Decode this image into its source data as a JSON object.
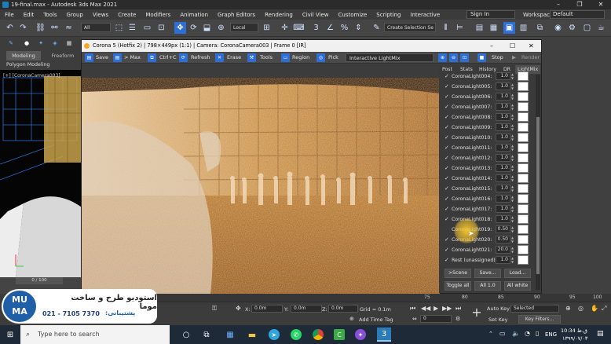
{
  "app": {
    "window_title": "19-final.max - Autodesk 3ds Max 2021"
  },
  "menu": [
    "File",
    "Edit",
    "Tools",
    "Group",
    "Views",
    "Create",
    "Modifiers",
    "Animation",
    "Graph Editors",
    "Rendering",
    "Civil View",
    "Customize",
    "Scripting",
    "Interactive"
  ],
  "account": {
    "sign_in": "Sign In",
    "workspaces_label": "Workspaces:",
    "workspace": "Default"
  },
  "toolbar": {
    "filter": "All",
    "ref_coord": "Local",
    "selection_set": "Create Selection Se"
  },
  "ribbon": {
    "tab_modeling": "Modeling",
    "tab_freeform": "Freeform",
    "poly_modeling": "Polygon Modeling"
  },
  "viewport": {
    "label": "[+] [CoronaCamera003]"
  },
  "vfb": {
    "title": "Corona 5 (Hotfix 2) | 798×449px (1:1) | Camera: CoronaCamera003 | Frame 0 [IR]",
    "save": "Save",
    "max": "> Max",
    "ctrlc": "Ctrl+C",
    "refresh": "Refresh",
    "erase": "Erase",
    "tools": "Tools",
    "region": "Region",
    "pick": "Pick",
    "mode": "Interactive LightMix",
    "stop": "Stop",
    "render": "Render"
  },
  "panel": {
    "tabs": [
      "Post",
      "Stats",
      "History",
      "DR",
      "LightMix"
    ],
    "lights": [
      {
        "name": "CoronaLight004:",
        "value": "1.0",
        "checked": true
      },
      {
        "name": "CoronaLight005:",
        "value": "1.0",
        "checked": true
      },
      {
        "name": "CoronaLight006:",
        "value": "1.0",
        "checked": true
      },
      {
        "name": "CoronaLight007:",
        "value": "1.0",
        "checked": true
      },
      {
        "name": "CoronaLight008:",
        "value": "1.0",
        "checked": true
      },
      {
        "name": "CoronaLight009:",
        "value": "1.0",
        "checked": true
      },
      {
        "name": "CoronaLight010:",
        "value": "1.0",
        "checked": true
      },
      {
        "name": "CoronaLight011:",
        "value": "1.0",
        "checked": true
      },
      {
        "name": "CoronaLight012:",
        "value": "1.0",
        "checked": true
      },
      {
        "name": "CoronaLight013:",
        "value": "1.0",
        "checked": true
      },
      {
        "name": "CoronaLight014:",
        "value": "1.0",
        "checked": true
      },
      {
        "name": "CoronaLight015:",
        "value": "1.0",
        "checked": true
      },
      {
        "name": "CoronaLight016:",
        "value": "1.0",
        "checked": true
      },
      {
        "name": "CoronaLight017:",
        "value": "1.0",
        "checked": true
      },
      {
        "name": "CoronaLight018:",
        "value": "1.0",
        "checked": true
      },
      {
        "name": "CoronaLight019:",
        "value": "0.50",
        "checked": false
      },
      {
        "name": "CoronaLight020:",
        "value": "0.50",
        "checked": true
      },
      {
        "name": "CoronaLight021:",
        "value": "20.0",
        "checked": true
      },
      {
        "name": "Rest (unassigned):",
        "value": "1.0",
        "checked": true
      }
    ],
    "btn_scene": ">Scene",
    "btn_save": "Save...",
    "btn_load": "Load...",
    "btn_toggle": "Toggle all",
    "btn_all": "All 1.0",
    "btn_white": "All white"
  },
  "timeline": {
    "frame": "0 / 100",
    "ticks": [
      "75",
      "80",
      "85",
      "90",
      "95",
      "100"
    ]
  },
  "status": {
    "x_label": "X:",
    "x": "0.0m",
    "y_label": "Y:",
    "y": "0.0m",
    "z_label": "Z:",
    "z": "0.0m",
    "grid": "Grid = 0.1m",
    "add_time_tag": "Add Time Tag",
    "auto_key": "Auto Key",
    "set_key": "Set Key",
    "selected": "Selected",
    "key_filters": "Key Filters...",
    "frame_field": "0"
  },
  "logo": {
    "letters_top": "MU",
    "letters_bottom": "MA",
    "title": "استودیو طرح و ساخت موما",
    "support_label": "پشتیبانی:",
    "phone": "021 - 7105 7370"
  },
  "taskbar": {
    "search_placeholder": "Type here to search",
    "lang": "ENG",
    "time": "10:34 ق.ظ",
    "date": "۱۳۹۹/۰۷/۰۳"
  },
  "colors": {
    "accent": "#2e6fd6",
    "render_warm": "#c98a4a",
    "logo_blue": "#1e5fa8"
  }
}
